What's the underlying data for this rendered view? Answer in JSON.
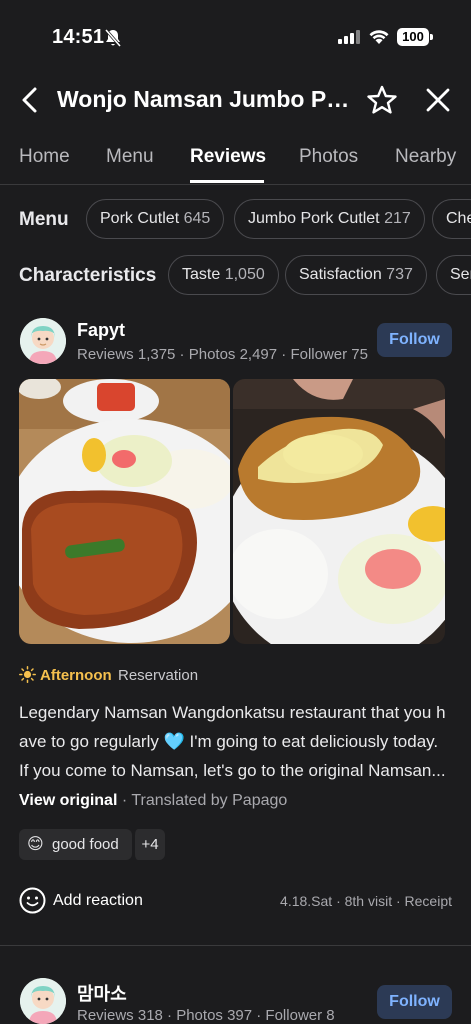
{
  "status_bar": {
    "time": "14:51",
    "battery": "100"
  },
  "header": {
    "title": "Wonjo Namsan Jumbo Por..."
  },
  "tabs": [
    {
      "label": "Home",
      "active": false
    },
    {
      "label": "Menu",
      "active": false
    },
    {
      "label": "Reviews",
      "active": true
    },
    {
      "label": "Photos",
      "active": false
    },
    {
      "label": "Nearby",
      "active": false
    }
  ],
  "filters": {
    "menu": {
      "label": "Menu",
      "chips": [
        {
          "name": "Pork Cutlet",
          "count": "645"
        },
        {
          "name": "Jumbo Pork Cutlet",
          "count": "217"
        },
        {
          "name": "Che",
          "count": ""
        }
      ]
    },
    "characteristics": {
      "label": "Characteristics",
      "chips": [
        {
          "name": "Taste",
          "count": "1,050"
        },
        {
          "name": "Satisfaction",
          "count": "737"
        },
        {
          "name": "Ser",
          "count": ""
        }
      ]
    }
  },
  "reviews": [
    {
      "name": "Fapyt",
      "stats": "Reviews 1,375 · Photos 2,497 · Follower 75",
      "follow_label": "Follow",
      "visit_time": "Afternoon",
      "visit_type": "Reservation",
      "text_lines": [
        "Legendary Namsan Wangdonkatsu restaurant that you h",
        "ave to go regularly",
        " I'm going to eat deliciously today.",
        "If you come to Namsan, let's go to the original Namsan..."
      ],
      "heart_emoji": "🩵",
      "view_original": "View original",
      "translated_by": " · Translated by Papago",
      "tag_emoji": "😊",
      "tag_label": "good food",
      "more_tags": "+4",
      "add_reaction": "Add reaction",
      "visit_meta": "4.18.Sat · 8th visit · Receipt"
    },
    {
      "name": "맘마소",
      "stats": "Reviews 318 · Photos 397 · Follower 8",
      "follow_label": "Follow"
    }
  ],
  "colors": {
    "background": "#1c1c1e",
    "accent_blue": "#7fb3ff",
    "follow_bg": "#2c3a55",
    "visit_time": "#f5c04e"
  }
}
